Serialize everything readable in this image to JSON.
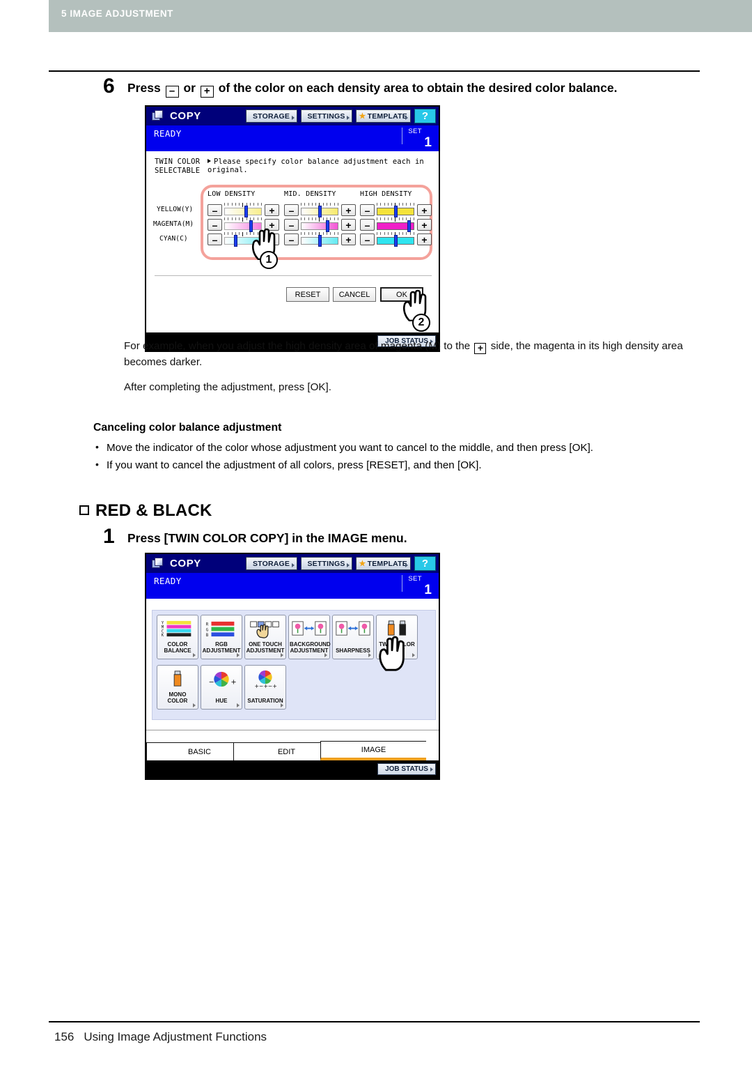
{
  "header": {
    "chapter": "5 IMAGE ADJUSTMENT"
  },
  "footer": {
    "page_number": "156",
    "title": "Using Image Adjustment Functions"
  },
  "step6": {
    "number": "6",
    "text_before": "Press",
    "minus_key": "–",
    "text_or": "or",
    "plus_key": "+",
    "text_after": "of the color on each density area to obtain the desired color balance."
  },
  "lcd1": {
    "title": "COPY",
    "toolbar": {
      "storage": "STORAGE",
      "settings": "SETTINGS",
      "template": "TEMPLATE",
      "help": "?"
    },
    "status": {
      "ready": "READY",
      "set_label": "SET",
      "set_value": "1"
    },
    "message_left": "TWIN COLOR\nSELECTABLE",
    "message_right": "Please specify color balance adjustment each in original.",
    "density_headers": [
      "LOW DENSITY",
      "MID. DENSITY",
      "HIGH DENSITY"
    ],
    "rows": [
      {
        "label": "YELLOW(Y)",
        "color": "#f5e33a",
        "sliders": [
          {
            "knob_pct": 58
          },
          {
            "knob_pct": 50
          },
          {
            "knob_pct": 50
          }
        ]
      },
      {
        "label": "MAGENTA(M)",
        "color": "#f020c8",
        "sliders": [
          {
            "knob_pct": 72
          },
          {
            "knob_pct": 72
          },
          {
            "knob_pct": 86
          }
        ]
      },
      {
        "label": "CYAN(C)",
        "color": "#2fe4ef",
        "sliders": [
          {
            "knob_pct": 30
          },
          {
            "knob_pct": 50
          },
          {
            "knob_pct": 50
          }
        ]
      }
    ],
    "minus": "–",
    "plus": "+",
    "buttons": {
      "reset": "RESET",
      "cancel": "CANCEL",
      "ok": "OK"
    },
    "job_status": "JOB STATUS",
    "callouts": {
      "one": "1",
      "two": "2"
    }
  },
  "example_paragraph_1": "For example, when you adjust the high density area of magenta (M) to the",
  "example_paragraph_1b": "side, the magenta in its high density area becomes darker.",
  "example_paragraph_2": "After completing the adjustment, press [OK].",
  "canceling": {
    "heading": "Canceling color balance adjustment",
    "bullets": [
      "Move the indicator of the color whose adjustment you want to cancel to the middle, and then press [OK].",
      "If you want to cancel the adjustment of all colors, press [RESET], and then [OK]."
    ]
  },
  "section": {
    "title": "RED & BLACK"
  },
  "step1": {
    "number": "1",
    "text": "Press [TWIN COLOR COPY] in the IMAGE menu."
  },
  "lcd2": {
    "title": "COPY",
    "toolbar": {
      "storage": "STORAGE",
      "settings": "SETTINGS",
      "template": "TEMPLATE",
      "help": "?"
    },
    "status": {
      "ready": "READY",
      "set_label": "SET",
      "set_value": "1"
    },
    "menu_buttons": [
      {
        "label": "COLOR\nBALANCE",
        "icon": "color-bars-ymck-icon"
      },
      {
        "label": "RGB\nADJUSTMENT",
        "icon": "color-bars-rgb-icon"
      },
      {
        "label": "ONE TOUCH\nADJUSTMENT",
        "icon": "one-touch-hand-icon"
      },
      {
        "label": "BACKGROUND\nADJUSTMENT",
        "icon": "background-pages-icon"
      },
      {
        "label": "SHARPNESS",
        "icon": "sharpness-pages-icon"
      },
      {
        "label": "TWIN COLOR\nCOPY",
        "icon": "twin-color-tubes-icon"
      },
      {
        "label": "MONO\nCOLOR",
        "icon": "mono-color-tube-icon"
      },
      {
        "label": "HUE",
        "icon": "hue-wheel-icon"
      },
      {
        "label": "SATURATION",
        "icon": "saturation-wheel-icon"
      }
    ],
    "tabs": [
      {
        "label": "BASIC",
        "active": false
      },
      {
        "label": "EDIT",
        "active": false
      },
      {
        "label": "IMAGE",
        "active": true
      }
    ],
    "job_status": "JOB STATUS"
  },
  "colors": {
    "header_bar": "#b4c0bd",
    "lcd_titlebar": "#00007a",
    "lcd_status": "#0000ee",
    "highlight_ring": "#f4a29b",
    "tab_active_underline": "#f0a020",
    "menu_bg": "#dfe4f7"
  }
}
